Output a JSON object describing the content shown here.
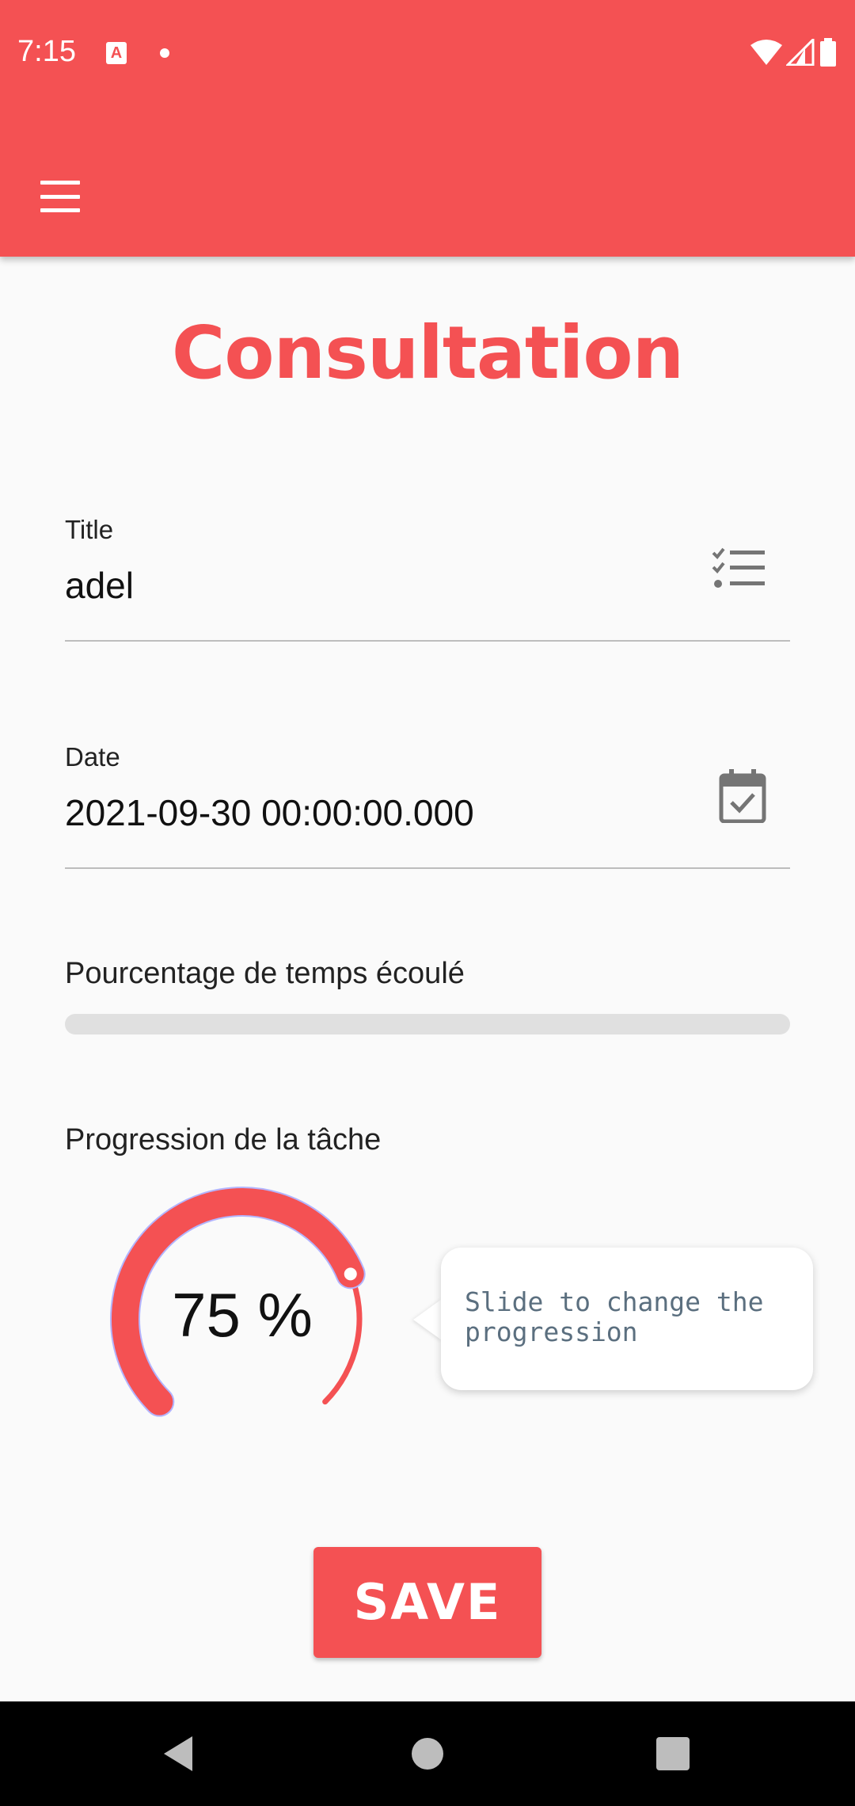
{
  "status_bar": {
    "time": "7:15",
    "notification_icons": [
      "app-a-icon",
      "dot-icon"
    ],
    "system_icons": [
      "wifi-icon",
      "signal-icon",
      "battery-icon"
    ]
  },
  "app_bar": {
    "menu_icon": "hamburger-menu-icon",
    "color": "#f45153"
  },
  "page": {
    "title": "Consultation"
  },
  "form": {
    "title_field": {
      "label": "Title",
      "value": "adel",
      "icon": "checklist-icon"
    },
    "date_field": {
      "label": "Date",
      "value": "2021-09-30 00:00:00.000",
      "icon": "calendar-check-icon"
    },
    "elapsed": {
      "label": "Pourcentage de temps écoulé",
      "fraction": 0
    },
    "progression": {
      "label": "Progression de la tâche",
      "value_text": "75 %",
      "value": 75,
      "tooltip": "Slide to change the progression"
    },
    "save_label": "SAVE"
  },
  "nav_bar": {
    "icons": [
      "back-icon",
      "home-icon",
      "recents-icon"
    ]
  },
  "colors": {
    "accent": "#f45153",
    "background": "#fafafa",
    "tooltip_text": "#5b6f7f"
  }
}
